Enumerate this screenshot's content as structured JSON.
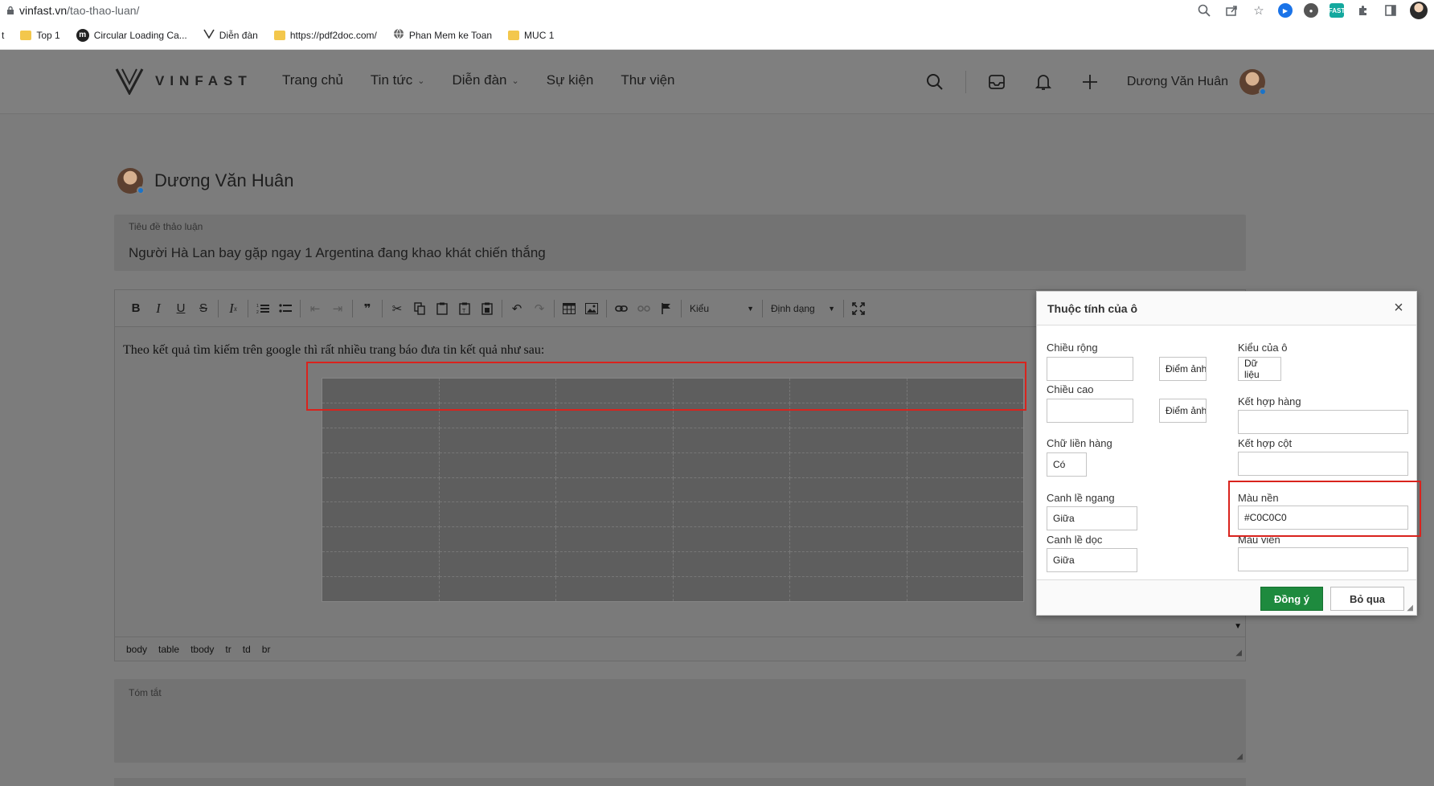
{
  "browser": {
    "url_host": "vinfast.vn",
    "url_path": "/tao-thao-luan/",
    "toolbar_icons": [
      "zoom-icon",
      "share-icon",
      "star-icon",
      "extension-icon",
      "puzzle-icon",
      "sidepanel-icon",
      "profile-avatar"
    ],
    "ext_badge": "FAST"
  },
  "bookmarks": [
    {
      "icon": "t-fragment",
      "label": "t"
    },
    {
      "icon": "folder-icon",
      "label": "Top 1"
    },
    {
      "icon": "m-icon",
      "label": "Circular Loading Ca..."
    },
    {
      "icon": "vinfast-icon",
      "label": "Diễn đàn"
    },
    {
      "icon": "folder-icon",
      "label": "https://pdf2doc.com/"
    },
    {
      "icon": "globe-icon",
      "label": "Phan Mem ke Toan"
    },
    {
      "icon": "folder-icon",
      "label": "MUC 1"
    }
  ],
  "header": {
    "logo": "VINFAST",
    "nav": [
      {
        "label": "Trang chủ",
        "dropdown": false
      },
      {
        "label": "Tin tức",
        "dropdown": true
      },
      {
        "label": "Diễn đàn",
        "dropdown": true
      },
      {
        "label": "Sự kiện",
        "dropdown": false
      },
      {
        "label": "Thư viện",
        "dropdown": false
      }
    ],
    "user_name": "Dương Văn Huân"
  },
  "post": {
    "author": "Dương Văn Huân",
    "title_label": "Tiêu đề thảo luận",
    "title_value": "Người Hà Lan bay gặp ngay 1 Argentina đang khao khát chiến thắng",
    "body_text": "Theo kết quả tìm kiếm trên google thì rất nhiều trang báo đưa tin kết quả như sau:",
    "style_combo": "Kiểu",
    "format_combo": "Định dạng",
    "path": [
      "body",
      "table",
      "tbody",
      "tr",
      "td",
      "br"
    ],
    "summary_label": "Tóm tắt"
  },
  "table": {
    "rows": 9,
    "cols": 6
  },
  "dialog": {
    "title": "Thuộc tính của ô",
    "width_label": "Chiều rộng",
    "width_value": "",
    "width_unit": "Điểm ảnh",
    "height_label": "Chiều cao",
    "height_value": "",
    "height_unit": "Điểm ảnh",
    "wrap_label": "Chữ liền hàng",
    "wrap_value": "Có",
    "halign_label": "Canh lề ngang",
    "halign_value": "Giữa",
    "valign_label": "Canh lề dọc",
    "valign_value": "Giữa",
    "celltype_label": "Kiểu của ô",
    "celltype_value": "Dữ liệu",
    "rowspan_label": "Kết hợp hàng",
    "rowspan_value": "",
    "colspan_label": "Kết hợp cột",
    "colspan_value": "",
    "bgcolor_label": "Màu nền",
    "bgcolor_value": "#C0C0C0",
    "border_label": "Màu viền",
    "border_value": "",
    "ok_label": "Đồng ý",
    "cancel_label": "Bỏ qua"
  },
  "colors": {
    "accent_green": "#1e8a3e",
    "highlight_red": "#d9231d"
  }
}
